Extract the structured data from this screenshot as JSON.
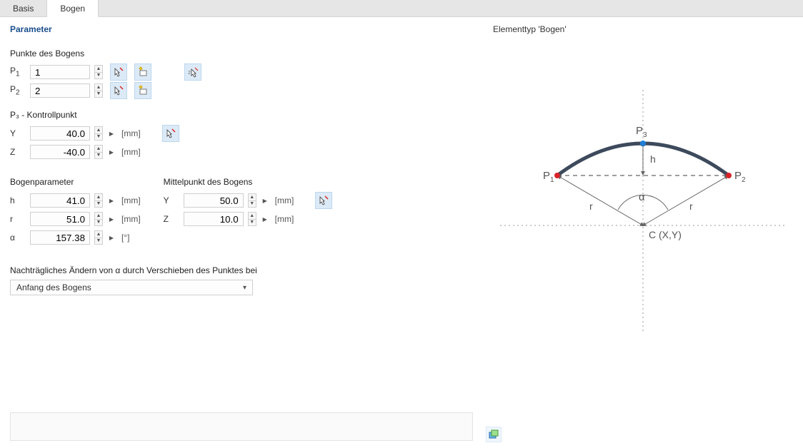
{
  "tabs": {
    "basis": "Basis",
    "bogen": "Bogen"
  },
  "left_panel": {
    "title": "Parameter",
    "points_section": "Punkte des Bogens",
    "p1_label": "P",
    "p1_sub": "1",
    "p1_value": "1",
    "p2_label": "P",
    "p2_sub": "2",
    "p2_value": "2",
    "control_section": "P₃ - Kontrollpunkt",
    "y_label": "Y",
    "y_value": "40.0",
    "y_unit": "[mm]",
    "z_label": "Z",
    "z_value": "-40.0",
    "z_unit": "[mm]",
    "arcparam_section": "Bogenparameter",
    "h_label": "h",
    "h_value": "41.0",
    "h_unit": "[mm]",
    "r_label": "r",
    "r_value": "51.0",
    "r_unit": "[mm]",
    "a_label": "α",
    "a_value": "157.38",
    "a_unit": "[°]",
    "center_section": "Mittelpunkt des Bogens",
    "cy_label": "Y",
    "cy_value": "50.0",
    "cy_unit": "[mm]",
    "cz_label": "Z",
    "cz_value": "10.0",
    "cz_unit": "[mm]",
    "change_section": "Nachträgliches Ändern von α durch Verschieben des Punktes bei",
    "change_select": "Anfang des Bogens"
  },
  "right_panel": {
    "title": "Elementtyp 'Bogen'",
    "labels": {
      "p1": "P",
      "p1s": "1",
      "p2": "P",
      "p2s": "2",
      "p3": "P",
      "p3s": "3",
      "h": "h",
      "r1": "r",
      "r2": "r",
      "alpha": "α",
      "c": "C (X,Y)"
    }
  }
}
